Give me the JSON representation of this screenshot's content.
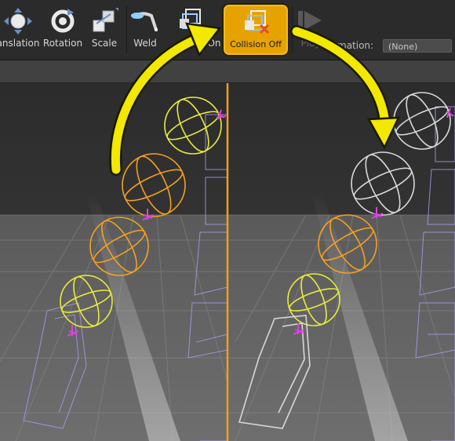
{
  "toolbar": {
    "buttons": [
      {
        "id": "translation",
        "label": "anslation",
        "icon": "translate-icon"
      },
      {
        "id": "rotation",
        "label": "Rotation",
        "icon": "rotate-icon"
      },
      {
        "id": "scale",
        "label": "Scale",
        "icon": "scale-icon"
      },
      {
        "id": "weld",
        "label": "Weld",
        "icon": "weld-icon"
      },
      {
        "id": "collision_on_1",
        "label": "C",
        "icon": "collision-on-icon"
      },
      {
        "id": "collision_on_2",
        "label": "On",
        "icon": ""
      },
      {
        "id": "collision_off",
        "label": "Collision Off",
        "icon": "collision-off-icon",
        "highlighted": true
      },
      {
        "id": "play",
        "label": "Play",
        "icon": "play-icon",
        "disabled": true
      }
    ],
    "animation_label": "mation:",
    "animation_value": "(None)"
  },
  "colors": {
    "highlight": "#e6a300",
    "arrow": "#f2e800",
    "selected_body": "#f5a020",
    "body_yellow": "#e9ec3a",
    "body_white": "#d8d8d8",
    "constraint": "#e040e0",
    "mesh_wire": "#a99ae8",
    "divider": "#f0a020"
  }
}
